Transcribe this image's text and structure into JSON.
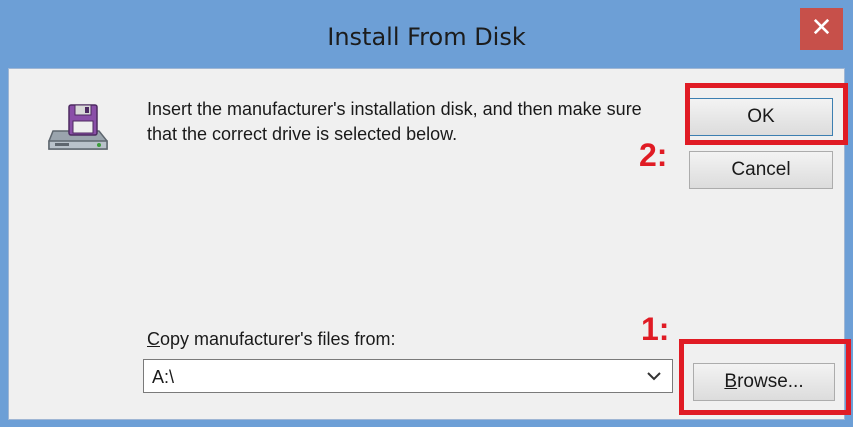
{
  "window": {
    "title": "Install From Disk",
    "close_glyph": "✕"
  },
  "dialog": {
    "icon": "floppy-disk-drive-icon",
    "instruction": "Insert the manufacturer's installation disk, and then make sure that the correct drive is selected below.",
    "ok_label": "OK",
    "cancel_label": "Cancel",
    "copy_label_rest": "opy manufacturer's files from:",
    "copy_label_accel": "C",
    "path_value": "A:\\",
    "browse_accel": "B",
    "browse_rest": "rowse..."
  },
  "annotations": {
    "step_ok": "2:",
    "step_browse": "1:",
    "highlight_color": "#e01b24"
  },
  "colors": {
    "titlebar": "#6d9fd6",
    "close_button": "#c7504a",
    "client_background": "#f0f0f0"
  }
}
